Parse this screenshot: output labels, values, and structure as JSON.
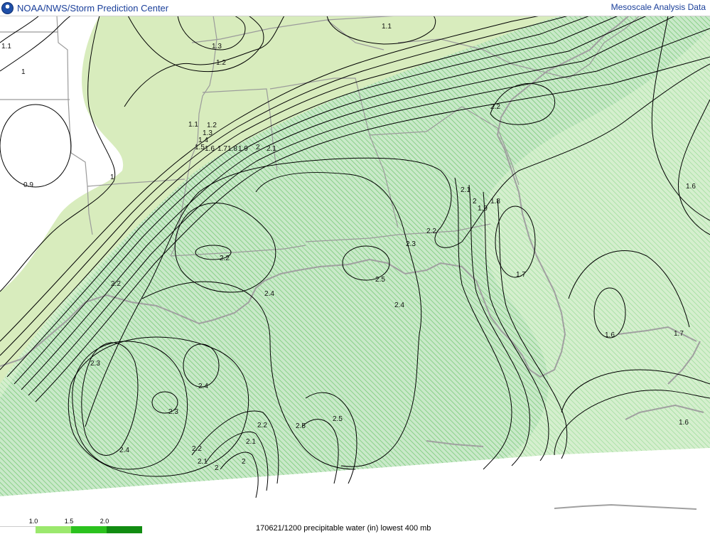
{
  "header": {
    "title": "NOAA/NWS/Storm Prediction Center",
    "product": "Mesoscale Analysis Data"
  },
  "footer": {
    "caption": "170621/1200 precipitable water (in) lowest 400 mb",
    "legend": [
      {
        "label": "1.0",
        "color": "#9be86d"
      },
      {
        "label": "1.5",
        "color": "#2bc21e"
      },
      {
        "label": "2.0",
        "color": "#118c11"
      }
    ]
  },
  "colors": {
    "light_green_fill": "#d8ecbd",
    "medium_green_fill": "#bfe6bf",
    "hatch_green": "#7fcf7f",
    "boundary_gray": "#9b9b9b",
    "contour": "#000000"
  },
  "map": {
    "contour_labels": [
      {
        "id": "l11-a",
        "text": "1.1"
      },
      {
        "id": "l1-a",
        "text": "1"
      },
      {
        "id": "l09-a",
        "text": "0.9"
      },
      {
        "id": "l13-a",
        "text": "1.3"
      },
      {
        "id": "l12-a",
        "text": "1.2"
      },
      {
        "id": "l11-b",
        "text": "1.1"
      },
      {
        "id": "l22-a",
        "text": "2.2"
      },
      {
        "id": "l16-a",
        "text": "1.6"
      },
      {
        "id": "l11-c",
        "text": "1.1"
      },
      {
        "id": "l12-b",
        "text": "1.2"
      },
      {
        "id": "l13-b",
        "text": "1.3"
      },
      {
        "id": "l14-a",
        "text": "1.4"
      },
      {
        "id": "l15-a",
        "text": "1.5"
      },
      {
        "id": "l16-b",
        "text": "1.6"
      },
      {
        "id": "l17-a",
        "text": "1.7"
      },
      {
        "id": "l18-a",
        "text": "1.8"
      },
      {
        "id": "l19-a",
        "text": "1.9"
      },
      {
        "id": "l2-a",
        "text": "2"
      },
      {
        "id": "l21-a",
        "text": "2.1"
      },
      {
        "id": "l1-b",
        "text": "1"
      },
      {
        "id": "l21-b",
        "text": "2.1"
      },
      {
        "id": "l2-b",
        "text": "2"
      },
      {
        "id": "l19-b",
        "text": "1.9"
      },
      {
        "id": "l18-b",
        "text": "1.8"
      },
      {
        "id": "l22-b",
        "text": "2.2"
      },
      {
        "id": "l23-a",
        "text": "2.3"
      },
      {
        "id": "l22-c",
        "text": "2.2"
      },
      {
        "id": "l17-b",
        "text": "1.7"
      },
      {
        "id": "l22-d",
        "text": "2.2"
      },
      {
        "id": "l24-a",
        "text": "2.4"
      },
      {
        "id": "l25-a",
        "text": "2.5"
      },
      {
        "id": "l24-b",
        "text": "2.4"
      },
      {
        "id": "l16-c",
        "text": "1.6"
      },
      {
        "id": "l17-c",
        "text": "1.7"
      },
      {
        "id": "l23-b",
        "text": "2.3"
      },
      {
        "id": "l24-c",
        "text": "2.4"
      },
      {
        "id": "l23-c",
        "text": "2.3"
      },
      {
        "id": "l24-d",
        "text": "2.4"
      },
      {
        "id": "l22-e",
        "text": "2.2"
      },
      {
        "id": "l21-c",
        "text": "2.1"
      },
      {
        "id": "l2-c",
        "text": "2"
      },
      {
        "id": "l2-d",
        "text": "2"
      },
      {
        "id": "l21-d",
        "text": "2.1"
      },
      {
        "id": "l22-f",
        "text": "2.2"
      },
      {
        "id": "l25-b",
        "text": "2.5"
      },
      {
        "id": "l25-c",
        "text": "2.5"
      },
      {
        "id": "l16-d",
        "text": "1.6"
      }
    ]
  }
}
